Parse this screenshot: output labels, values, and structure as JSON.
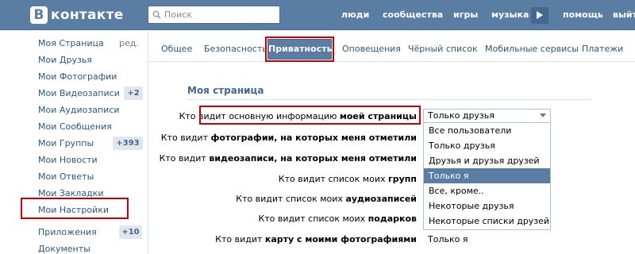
{
  "header": {
    "logo_letter": "В",
    "logo_text": "контакте",
    "search_placeholder": "Поиск",
    "nav": [
      "люди",
      "сообщества",
      "игры",
      "музыка",
      "помощь",
      "выйт"
    ]
  },
  "sidebar": {
    "items": [
      {
        "label": "Моя Страница",
        "extra": "ред."
      },
      {
        "label": "Мои Друзья"
      },
      {
        "label": "Мои Фотографии"
      },
      {
        "label": "Мои Видеозаписи",
        "badge": "+2"
      },
      {
        "label": "Мои Аудиозаписи"
      },
      {
        "label": "Мои Сообщения"
      },
      {
        "label": "Мои Группы",
        "badge": "+393"
      },
      {
        "label": "Мои Новости"
      },
      {
        "label": "Мои Ответы"
      },
      {
        "label": "Мои Закладки"
      },
      {
        "label": "Мои Настройки"
      },
      {
        "label": "Приложения",
        "badge": "+10"
      },
      {
        "label": "Документы"
      }
    ]
  },
  "tabs": [
    "Общее",
    "Безопасность",
    "Приватность",
    "Оповещения",
    "Чёрный список",
    "Мобильные сервисы",
    "Платежи"
  ],
  "active_tab": "Приватность",
  "section": {
    "title": "Моя страница"
  },
  "rows": [
    {
      "pre": "Кто видит основную информацию ",
      "bold": "моей страницы"
    },
    {
      "pre": "Кто видит ",
      "bold": "фотографии, на которых меня отметили"
    },
    {
      "pre": "Кто видит ",
      "bold": "видеозаписи, на которых меня отметили"
    },
    {
      "pre": "Кто видит список моих ",
      "bold": "групп"
    },
    {
      "pre": "Кто видит список моих ",
      "bold": "аудиозаписей"
    },
    {
      "pre": "Кто видит список моих ",
      "bold": "подарков"
    },
    {
      "pre": "Кто видит ",
      "bold": "карту с моими фотографиями"
    }
  ],
  "select": {
    "value": "Только друзья",
    "options": [
      "Все пользователи",
      "Только друзья",
      "Друзья и друзья друзей",
      "Только я",
      "Все, кроме..",
      "Некоторые друзья",
      "Некоторые списки друзей"
    ],
    "highlighted": "Только я"
  },
  "last_row_value": "Только я",
  "colors": {
    "header": "#597da3",
    "link": "#2b587a",
    "annotation": "#c80000"
  }
}
